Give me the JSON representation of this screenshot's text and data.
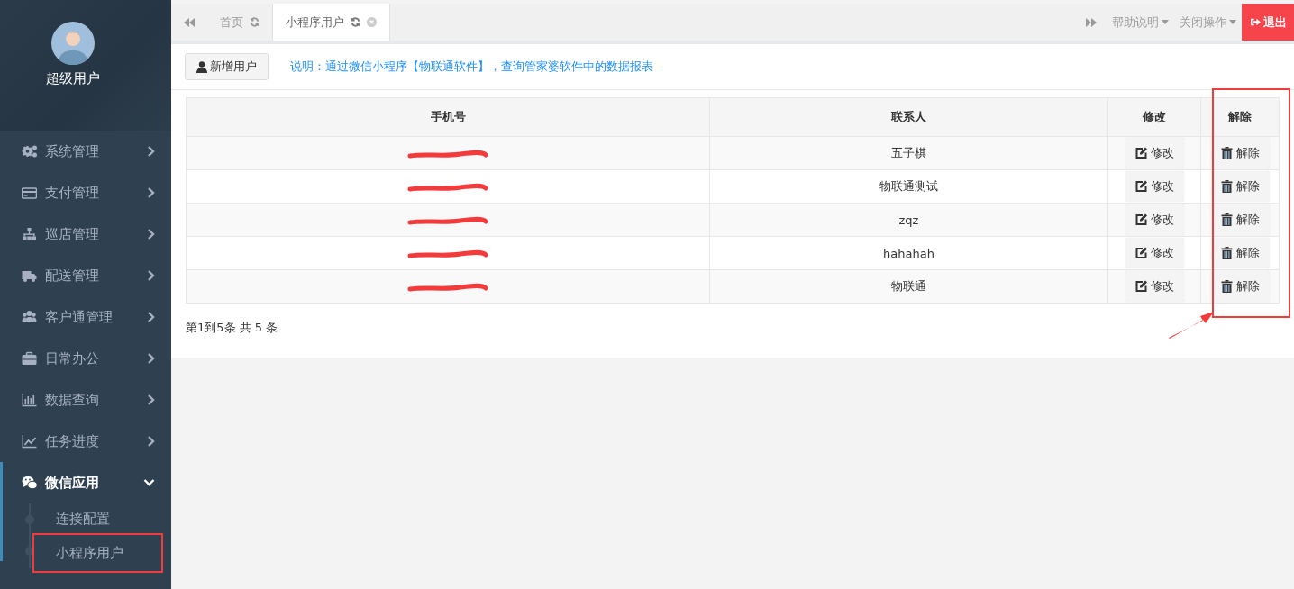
{
  "sidebar": {
    "user": "超级用户",
    "menu": [
      {
        "label": "系统管理",
        "expanded": false
      },
      {
        "label": "支付管理",
        "expanded": false
      },
      {
        "label": "巡店管理",
        "expanded": false
      },
      {
        "label": "配送管理",
        "expanded": false
      },
      {
        "label": "客户通管理",
        "expanded": false
      },
      {
        "label": "日常办公",
        "expanded": false
      },
      {
        "label": "数据查询",
        "expanded": false
      },
      {
        "label": "任务进度",
        "expanded": false
      },
      {
        "label": "微信应用",
        "expanded": true,
        "children": [
          {
            "label": "连接配置",
            "highlighted": false
          },
          {
            "label": "小程序用户",
            "highlighted": true
          }
        ]
      }
    ]
  },
  "tabs": [
    {
      "label": "首页",
      "selected": false
    },
    {
      "label": "小程序用户",
      "selected": true
    }
  ],
  "top_actions": [
    "帮助说明",
    "关闭操作"
  ],
  "logout": "退出",
  "toolbar": {
    "add_button": "新增用户",
    "note": "说明：通过微信小程序【物联通软件】，查询管家婆软件中的数据报表"
  },
  "table": {
    "columns": [
      {
        "label": "手机号",
        "highlighted": false
      },
      {
        "label": "联系人",
        "highlighted": false
      },
      {
        "label": "修改",
        "highlighted": false
      },
      {
        "label": "解除",
        "highlighted": true
      }
    ],
    "rows": [
      {
        "contact": "五子棋",
        "edit": "修改",
        "remove": "解除"
      },
      {
        "contact": "物联通测试",
        "edit": "修改",
        "remove": "解除"
      },
      {
        "contact": "zqz",
        "edit": "修改",
        "remove": "解除"
      },
      {
        "contact": "hahahah",
        "edit": "修改",
        "remove": "解除"
      },
      {
        "contact": "物联通",
        "edit": "修改",
        "remove": "解除"
      }
    ]
  },
  "pagination": "第1到5条 共 5 条"
}
